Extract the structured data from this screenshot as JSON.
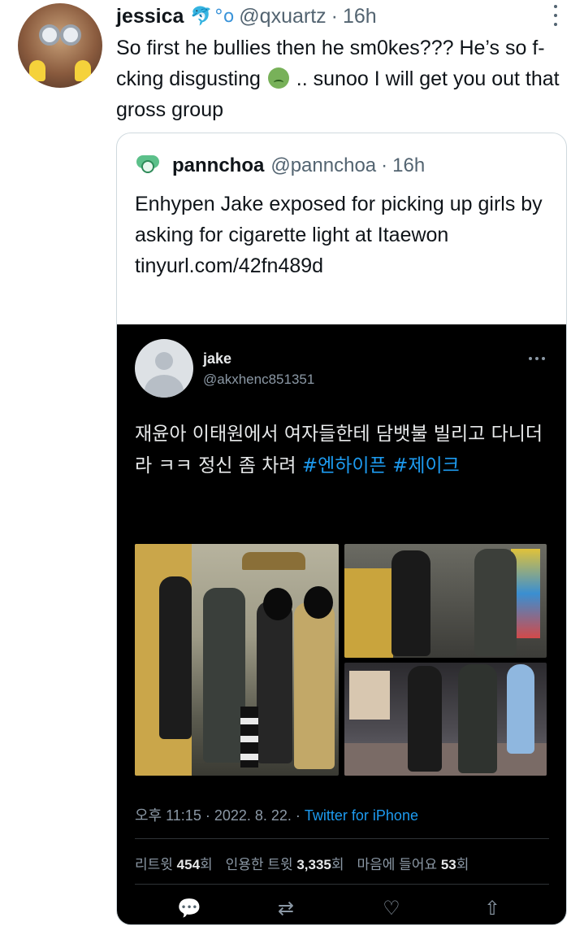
{
  "tweet": {
    "author_name": "jessica",
    "author_emoji_icons": [
      "dolphin-icon",
      "bubbles-icon"
    ],
    "handle": "@qxuartz",
    "separator": "·",
    "time": "16h",
    "text_before_emoji": "So first he bullies then he sm0kes??? He’s so f-cking disgusting",
    "emoji": "nauseated-face-icon",
    "text_after_emoji": ".. sunoo I will get you out that gross group"
  },
  "quote": {
    "author_name": "pannchoa",
    "handle": "@pannchoa",
    "separator": "·",
    "time": "16h",
    "text": "Enhypen Jake exposed for picking up girls by asking for cigarette light at Itaewon",
    "link": "tinyurl.com/42fn489d"
  },
  "screenshot": {
    "name": "jake",
    "handle": "@akxhenc851351",
    "text": "재윤아 이태원에서 여자들한테 담뱃불 빌리고 다니더라 ㅋㅋ 정신 좀 차려 ",
    "hashtag1": "#엔하이픈",
    "hashtag2": "#제이크",
    "timestamp": "오후 11:15 · 2022. 8. 22. · ",
    "source": "Twitter for iPhone",
    "stats": {
      "retweets_label": "리트윗",
      "retweets": "454",
      "retweets_unit": "회",
      "quotes_label": "인용한 트윗",
      "quotes": "3,335",
      "quotes_unit": "회",
      "likes_label": "마음에 들어요",
      "likes": "53",
      "likes_unit": "회"
    },
    "actions": {
      "reply": "💬",
      "retweet": "⇄",
      "like": "♡",
      "share": "⇧"
    }
  }
}
